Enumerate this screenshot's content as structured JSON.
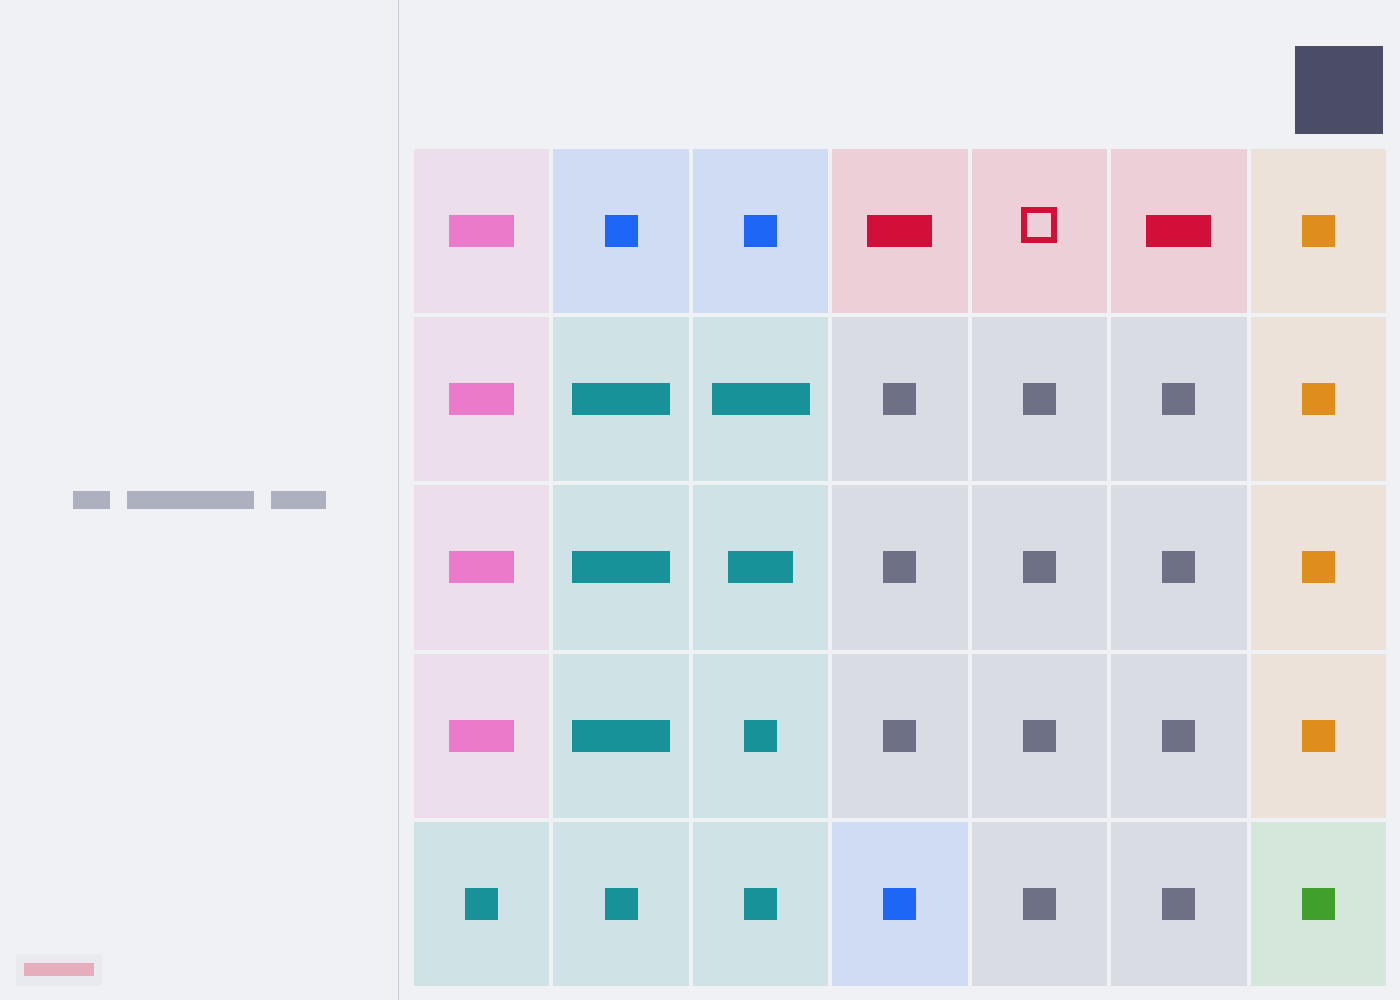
{
  "colors": {
    "background": "#eff1f5",
    "pink": "#ea7bca",
    "blue": "#1e66f5",
    "red": "#d20f39",
    "orange": "#df8e1d",
    "teal": "#179299",
    "gray": "#6e7085",
    "green": "#40a02b",
    "corner_tile": "#4b4d66"
  },
  "board": {
    "rows": 5,
    "cols": 7,
    "cells": [
      [
        {
          "color": "pink",
          "piece": "block",
          "units": 2
        },
        {
          "color": "blue",
          "piece": "block",
          "units": 1
        },
        {
          "color": "blue",
          "piece": "block",
          "units": 1
        },
        {
          "color": "red",
          "piece": "block",
          "units": 2
        },
        {
          "color": "red",
          "piece": "ring",
          "units": 1
        },
        {
          "color": "red",
          "piece": "block",
          "units": 2
        },
        {
          "color": "orange",
          "piece": "block",
          "units": 1
        }
      ],
      [
        {
          "color": "pink",
          "piece": "block",
          "units": 2
        },
        {
          "color": "teal",
          "piece": "block",
          "units": 3
        },
        {
          "color": "teal",
          "piece": "block",
          "units": 3
        },
        {
          "color": "gray",
          "piece": "block",
          "units": 1
        },
        {
          "color": "gray",
          "piece": "block",
          "units": 1
        },
        {
          "color": "gray",
          "piece": "block",
          "units": 1
        },
        {
          "color": "orange",
          "piece": "block",
          "units": 1
        }
      ],
      [
        {
          "color": "pink",
          "piece": "block",
          "units": 2
        },
        {
          "color": "teal",
          "piece": "block",
          "units": 3
        },
        {
          "color": "teal",
          "piece": "block",
          "units": 2
        },
        {
          "color": "gray",
          "piece": "block",
          "units": 1
        },
        {
          "color": "gray",
          "piece": "block",
          "units": 1
        },
        {
          "color": "gray",
          "piece": "block",
          "units": 1
        },
        {
          "color": "orange",
          "piece": "block",
          "units": 1
        }
      ],
      [
        {
          "color": "pink",
          "piece": "block",
          "units": 2
        },
        {
          "color": "teal",
          "piece": "block",
          "units": 3
        },
        {
          "color": "teal",
          "piece": "block",
          "units": 1
        },
        {
          "color": "gray",
          "piece": "block",
          "units": 1
        },
        {
          "color": "gray",
          "piece": "block",
          "units": 1
        },
        {
          "color": "gray",
          "piece": "block",
          "units": 1
        },
        {
          "color": "orange",
          "piece": "block",
          "units": 1
        }
      ],
      [
        {
          "color": "teal",
          "piece": "block",
          "units": 1
        },
        {
          "color": "teal",
          "piece": "block",
          "units": 1
        },
        {
          "color": "teal",
          "piece": "block",
          "units": 1
        },
        {
          "color": "blue",
          "piece": "block",
          "units": 1
        },
        {
          "color": "gray",
          "piece": "block",
          "units": 1
        },
        {
          "color": "gray",
          "piece": "block",
          "units": 1
        },
        {
          "color": "green",
          "piece": "block",
          "units": 1
        }
      ]
    ]
  }
}
